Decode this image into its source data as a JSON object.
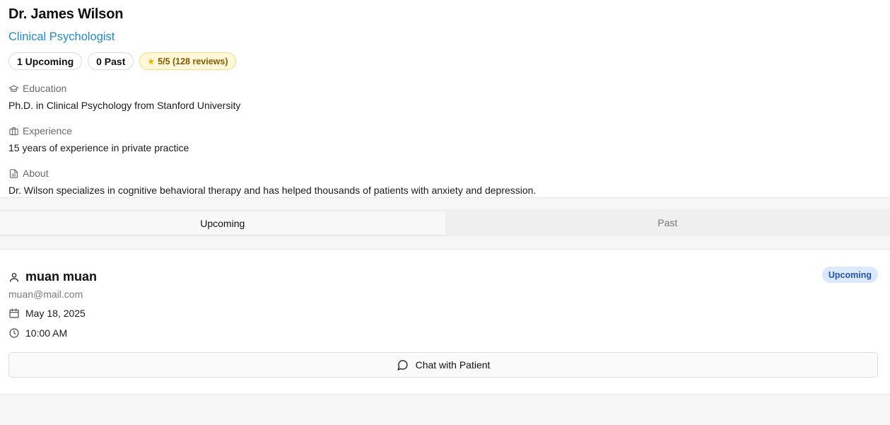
{
  "doctor": {
    "name": "Dr. James Wilson",
    "title": "Clinical Psychologist",
    "upcoming_count": "1 Upcoming",
    "past_count": "0 Past",
    "rating": "5/5 (128 reviews)",
    "education_label": "Education",
    "education": "Ph.D. in Clinical Psychology from Stanford University",
    "experience_label": "Experience",
    "experience": "15 years of experience in private practice",
    "about_label": "About",
    "about": "Dr. Wilson specializes in cognitive behavioral therapy and has helped thousands of patients with anxiety and depression."
  },
  "tabs": [
    {
      "label": "Upcoming",
      "active": true
    },
    {
      "label": "Past",
      "active": false
    }
  ],
  "appointment": {
    "patient_name": "muan muan",
    "email": "muan@mail.com",
    "status": "Upcoming",
    "date": "May 18, 2025",
    "time": "10:00 AM",
    "chat_label": "Chat with Patient"
  },
  "colors": {
    "accent": "#1e8bd8",
    "status_bg": "#dce8fb",
    "status_text": "#2453b8",
    "rating_bg": "#fef8d9",
    "rating_text": "#8a5a00"
  },
  "icons": [
    "graduation-cap-icon",
    "briefcase-icon",
    "document-icon",
    "user-icon",
    "calendar-icon",
    "clock-icon",
    "message-circle-icon",
    "star-icon"
  ]
}
